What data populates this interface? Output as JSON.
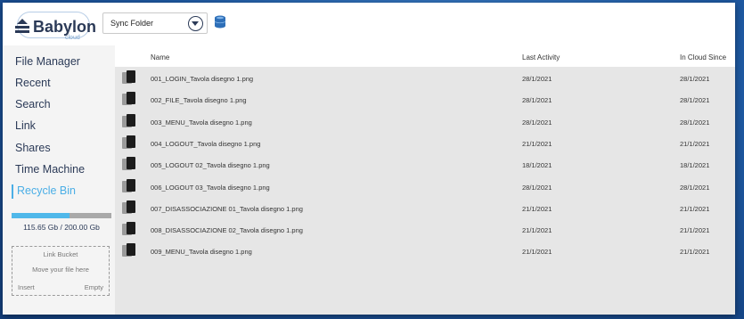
{
  "brand": {
    "name": "Babylon",
    "sub": "cloud"
  },
  "toolbar": {
    "folder_value": "Sync Folder"
  },
  "sidebar": {
    "items": [
      {
        "label": "File Manager",
        "active": false
      },
      {
        "label": "Recent",
        "active": false
      },
      {
        "label": "Search",
        "active": false
      },
      {
        "label": "Link",
        "active": false
      },
      {
        "label": "Shares",
        "active": false
      },
      {
        "label": "Time Machine",
        "active": false
      },
      {
        "label": "Recycle Bin",
        "active": true
      }
    ],
    "quota": {
      "text": "115.65 Gb / 200.00 Gb",
      "used_fraction": 0.578
    },
    "bucket": {
      "title": "Link Bucket",
      "hint": "Move your file here",
      "insert": "Insert",
      "empty": "Empty"
    }
  },
  "table": {
    "headers": {
      "name": "Name",
      "activity": "Last Activity",
      "cloud": "In Cloud Since"
    },
    "rows": [
      {
        "name": "001_LOGIN_Tavola disegno 1.png",
        "activity": "28/1/2021",
        "cloud": "28/1/2021"
      },
      {
        "name": "002_FILE_Tavola disegno 1.png",
        "activity": "28/1/2021",
        "cloud": "28/1/2021"
      },
      {
        "name": "003_MENU_Tavola disegno 1.png",
        "activity": "28/1/2021",
        "cloud": "28/1/2021"
      },
      {
        "name": "004_LOGOUT_Tavola disegno 1.png",
        "activity": "21/1/2021",
        "cloud": "21/1/2021"
      },
      {
        "name": "005_LOGOUT 02_Tavola disegno 1.png",
        "activity": "18/1/2021",
        "cloud": "18/1/2021"
      },
      {
        "name": "006_LOGOUT 03_Tavola disegno 1.png",
        "activity": "28/1/2021",
        "cloud": "28/1/2021"
      },
      {
        "name": "007_DISASSOCIAZIONE 01_Tavola disegno 1.png",
        "activity": "21/1/2021",
        "cloud": "21/1/2021"
      },
      {
        "name": "008_DISASSOCIAZIONE 02_Tavola disegno 1.png",
        "activity": "21/1/2021",
        "cloud": "21/1/2021"
      },
      {
        "name": "009_MENU_Tavola disegno 1.png",
        "activity": "21/1/2021",
        "cloud": "21/1/2021"
      }
    ]
  },
  "colors": {
    "accent": "#4aaee6",
    "nav_text": "#2b3a57",
    "table_bg": "#e6e6e6",
    "sidebar_bg": "#f4f4f4"
  }
}
